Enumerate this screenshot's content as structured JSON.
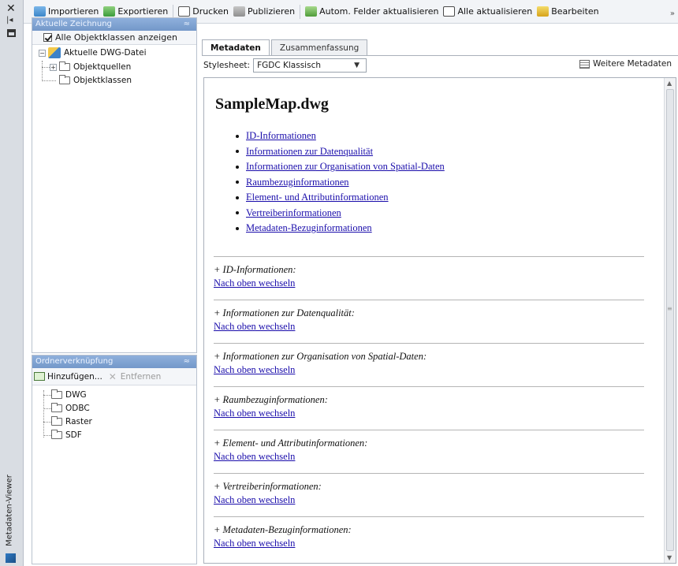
{
  "sidebar_strip": {
    "title": "Metadaten-Viewer",
    "close_icon": "close-icon",
    "pin_icon": "autohide-icon",
    "properties_icon": "properties-icon"
  },
  "toolbar": {
    "import_label": "Importieren",
    "export_label": "Exportieren",
    "print_label": "Drucken",
    "publish_label": "Publizieren",
    "autofield_label": "Autom. Felder aktualisieren",
    "refresh_all_label": "Alle aktualisieren",
    "edit_label": "Bearbeiten"
  },
  "current_drawing_panel": {
    "header": "Aktuelle Zeichnung",
    "show_all_checkbox": "Alle Objektklassen anzeigen",
    "show_all_checked": true,
    "tree": {
      "root": "Aktuelle DWG-Datei",
      "children": [
        "Objektquellen",
        "Objektklassen"
      ]
    }
  },
  "folder_link_panel": {
    "header": "Ordnerverknüpfung",
    "add_label": "Hinzufügen...",
    "remove_label": "Entfernen",
    "items": [
      "DWG",
      "ODBC",
      "Raster",
      "SDF"
    ]
  },
  "tabs": [
    {
      "label": "Metadaten",
      "active": true
    },
    {
      "label": "Zusammenfassung",
      "active": false
    }
  ],
  "stylesheet": {
    "label": "Stylesheet:",
    "value": "FGDC Klassisch",
    "more_label": "Weitere Metadaten"
  },
  "document": {
    "title": "SampleMap.dwg",
    "toc": [
      "ID-Informationen",
      "Informationen zur Datenqualität",
      "Informationen zur Organisation von Spatial-Daten",
      "Raumbezuginformationen",
      "Element- und Attributinformationen",
      "Vertreiberinformationen",
      "Metadaten-Bezuginformationen"
    ],
    "sections": [
      "+ ID-Informationen:",
      "+ Informationen zur Datenqualität:",
      "+ Informationen zur Organisation von Spatial-Daten:",
      "+ Raumbezuginformationen:",
      "+ Element- und Attributinformationen:",
      "+ Vertreiberinformationen:",
      "+ Metadaten-Bezuginformationen:"
    ],
    "back_to_top": "Nach oben wechseln"
  }
}
